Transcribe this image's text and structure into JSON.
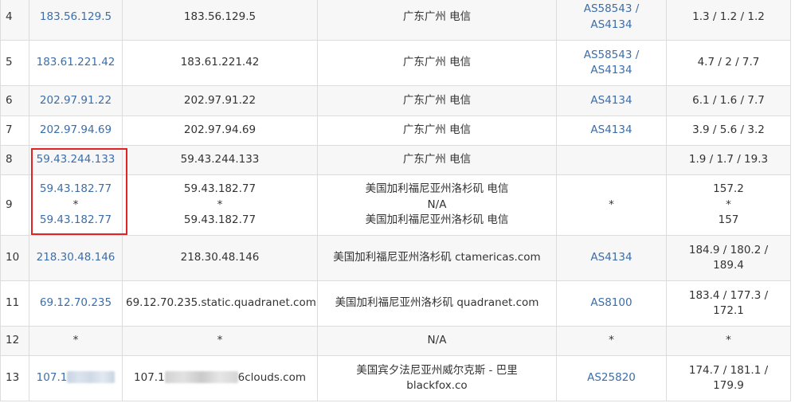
{
  "rows": [
    {
      "hop": "4",
      "ip": [
        "183.56.129.5"
      ],
      "host": [
        "183.56.129.5"
      ],
      "location": [
        "广东广州 电信"
      ],
      "asn": [
        "AS58543 /",
        "AS4134"
      ],
      "time": [
        "1.3 / 1.2 / 1.2"
      ]
    },
    {
      "hop": "5",
      "ip": [
        "183.61.221.42"
      ],
      "host": [
        "183.61.221.42"
      ],
      "location": [
        "广东广州 电信"
      ],
      "asn": [
        "AS58543 /",
        "AS4134"
      ],
      "time": [
        "4.7 / 2 / 7.7"
      ]
    },
    {
      "hop": "6",
      "ip": [
        "202.97.91.22"
      ],
      "host": [
        "202.97.91.22"
      ],
      "location": [
        "广东广州 电信"
      ],
      "asn": [
        "AS4134"
      ],
      "time": [
        "6.1 / 1.6 / 7.7"
      ]
    },
    {
      "hop": "7",
      "ip": [
        "202.97.94.69"
      ],
      "host": [
        "202.97.94.69"
      ],
      "location": [
        "广东广州 电信"
      ],
      "asn": [
        "AS4134"
      ],
      "time": [
        "3.9 / 5.6 / 3.2"
      ]
    },
    {
      "hop": "8",
      "ip": [
        "59.43.244.133"
      ],
      "host": [
        "59.43.244.133"
      ],
      "location": [
        "广东广州 电信"
      ],
      "asn": [],
      "time": [
        "1.9 / 1.7 / 19.3"
      ]
    },
    {
      "hop": "9",
      "ip": [
        "59.43.182.77",
        "*",
        "59.43.182.77"
      ],
      "host": [
        "59.43.182.77",
        "*",
        "59.43.182.77"
      ],
      "location": [
        "美国加利福尼亚州洛杉矶 电信",
        "N/A",
        "美国加利福尼亚州洛杉矶 电信"
      ],
      "asn": [
        "*"
      ],
      "time": [
        "157.2",
        "*",
        "157"
      ]
    },
    {
      "hop": "10",
      "ip": [
        "218.30.48.146"
      ],
      "host": [
        "218.30.48.146"
      ],
      "location": [
        "美国加利福尼亚州洛杉矶 ctamericas.com"
      ],
      "asn": [
        "AS4134"
      ],
      "time": [
        "184.9 / 180.2 /",
        "189.4"
      ]
    },
    {
      "hop": "11",
      "ip": [
        "69.12.70.235"
      ],
      "host": [
        "69.12.70.235.static.quadranet.com"
      ],
      "location": [
        "美国加利福尼亚州洛杉矶 quadranet.com"
      ],
      "asn": [
        "AS8100"
      ],
      "time": [
        "183.4 / 177.3 /",
        "172.1"
      ]
    },
    {
      "hop": "12",
      "ip": [
        "*"
      ],
      "host": [
        "*"
      ],
      "location": [
        "N/A"
      ],
      "asn": [
        "*"
      ],
      "time": [
        "*"
      ]
    },
    {
      "hop": "13",
      "ip_prefix": "107.1",
      "host_prefix": "107.1",
      "host_suffix": "6clouds.com",
      "location": [
        "美国宾夕法尼亚州威尔克斯 - 巴里",
        "blackfox.co"
      ],
      "asn": [
        "AS25820"
      ],
      "time": [
        "174.7 / 181.1 /",
        "179.9"
      ]
    }
  ],
  "colors": {
    "link": "#3d6ea8",
    "highlight_box": "#e02424",
    "stripe": "#f7f7f7",
    "border": "#dcdcdc"
  }
}
